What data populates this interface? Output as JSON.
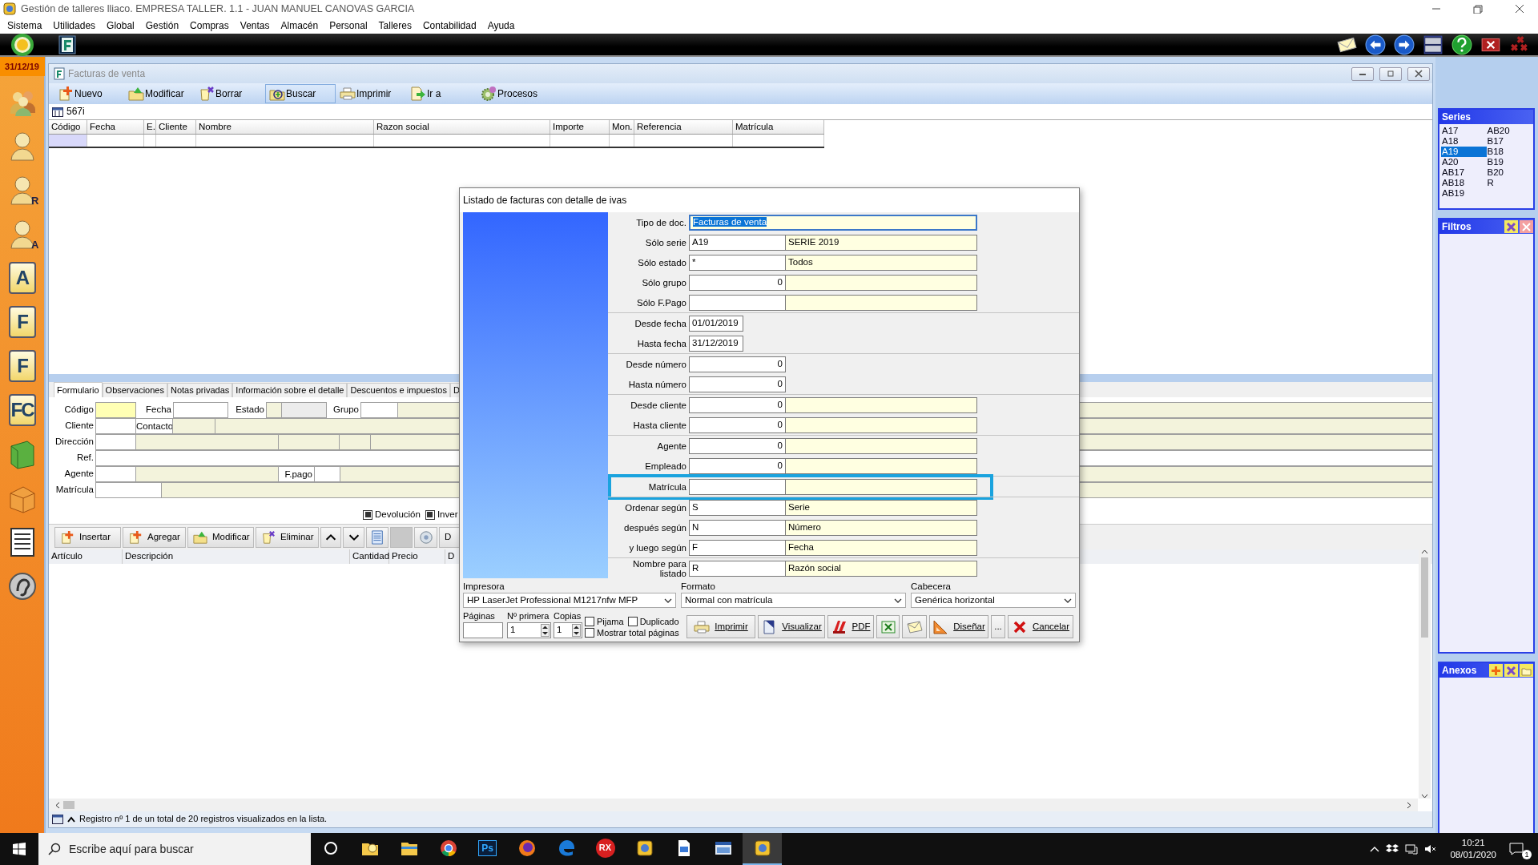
{
  "window": {
    "title": "Gestión de talleres lliaco. EMPRESA TALLER. 1.1 - JUAN MANUEL CANOVAS GARCIA"
  },
  "menu": [
    "Sistema",
    "Utilidades",
    "Global",
    "Gestión",
    "Compras",
    "Ventas",
    "Almacén",
    "Personal",
    "Talleres",
    "Contabilidad",
    "Ayuda"
  ],
  "date_badge": "31/12/19",
  "launcher": [
    {
      "kind": "people"
    },
    {
      "kind": "person"
    },
    {
      "kind": "person",
      "letter": "R"
    },
    {
      "kind": "person",
      "letter": "A"
    },
    {
      "kind": "tile",
      "letter": "A"
    },
    {
      "kind": "tile",
      "letter": "F"
    },
    {
      "kind": "tile",
      "letter": "F"
    },
    {
      "kind": "tile",
      "letter": "FC"
    },
    {
      "kind": "book"
    },
    {
      "kind": "box"
    },
    {
      "kind": "list"
    },
    {
      "kind": "disc"
    }
  ],
  "child_window": {
    "title": "Facturas de venta"
  },
  "toolbar": [
    {
      "label": "Nuevo",
      "kind": "add",
      "selected": false
    },
    {
      "label": "Modificar",
      "kind": "edit",
      "selected": false
    },
    {
      "label": "Borrar",
      "kind": "delete",
      "selected": false
    },
    {
      "label": "Buscar",
      "kind": "search",
      "selected": true
    },
    {
      "label": "Imprimir",
      "kind": "print",
      "selected": false
    },
    {
      "label": "Ir a",
      "kind": "goto",
      "selected": false
    },
    {
      "label": "Procesos",
      "kind": "gear",
      "selected": false
    }
  ],
  "record_search": "567i",
  "grid": {
    "columns": [
      "Código",
      "Fecha",
      "E.",
      "Cliente",
      "Nombre",
      "Razon social",
      "Importe",
      "Mon.",
      "Referencia",
      "Matrícula"
    ]
  },
  "detail_tabs": [
    {
      "label": "Formulario",
      "selected": true
    },
    {
      "label": "Observaciones",
      "selected": false
    },
    {
      "label": "Notas privadas",
      "selected": false
    },
    {
      "label": "Información sobre el detalle",
      "selected": false
    },
    {
      "label": "Descuentos e impuestos",
      "selected": false
    },
    {
      "label": "D",
      "selected": false
    }
  ],
  "form": {
    "labels": [
      "Código",
      "Fecha",
      "Estado",
      "Grupo",
      "Cliente",
      "Contacto",
      "Dirección",
      "Ref.",
      "Agente",
      "F.pago",
      "Matrícula"
    ]
  },
  "flags": [
    {
      "label": "Devolución",
      "checked": true
    },
    {
      "label": "Inver",
      "checked": true
    }
  ],
  "line_buttons": [
    {
      "kind": "add",
      "label": "Insertar"
    },
    {
      "kind": "add",
      "label": "Agregar"
    },
    {
      "kind": "edit",
      "label": "Modificar"
    },
    {
      "kind": "delete",
      "label": "Eliminar"
    },
    {
      "kind": "up"
    },
    {
      "kind": "down"
    },
    {
      "kind": "doc"
    },
    {
      "kind": "blank"
    },
    {
      "kind": "disc"
    },
    {
      "kind": "text",
      "label": "D"
    }
  ],
  "lines": {
    "columns": [
      "Artículo",
      "Descripción",
      "Cantidad",
      "Precio",
      "D"
    ]
  },
  "status_bar": "Registro nº 1 de un total de 20 registros visualizados en la lista.",
  "series": {
    "title": "Series",
    "items": [
      {
        "label": "A17",
        "selected": false
      },
      {
        "label": "A18",
        "selected": false
      },
      {
        "label": "A19",
        "selected": true
      },
      {
        "label": "A20",
        "selected": false
      },
      {
        "label": "AB17",
        "selected": false
      },
      {
        "label": "AB18",
        "selected": false
      },
      {
        "label": "AB19",
        "selected": false
      },
      {
        "label": "AB20",
        "selected": false
      },
      {
        "label": "B17",
        "selected": false
      },
      {
        "label": "B18",
        "selected": false
      },
      {
        "label": "B19",
        "selected": false
      },
      {
        "label": "B20",
        "selected": false
      },
      {
        "label": "R",
        "selected": false
      }
    ]
  },
  "filters": {
    "title": "Filtros"
  },
  "attachments": {
    "title": "Anexos"
  },
  "dialog": {
    "title": "Listado de facturas con detalle de ivas",
    "groups": [
      {
        "rows": [
          {
            "label": "Tipo de doc.",
            "kind": "doc",
            "code": "Facturas de venta",
            "selected_text": true
          },
          {
            "label": "Sólo serie",
            "kind": "pair",
            "code": "A19",
            "description": "SERIE 2019",
            "selected_text": false
          },
          {
            "label": "Sólo estado",
            "kind": "pair",
            "code": "*",
            "description": "Todos",
            "selected_text": false
          },
          {
            "label": "Sólo grupo",
            "kind": "numpair",
            "code": "0",
            "selected_text": false
          },
          {
            "label": "Sólo F.Pago",
            "kind": "pair"
          }
        ]
      },
      {
        "rows": [
          {
            "label": "Desde fecha",
            "kind": "date",
            "code": "01/01/2019",
            "selected_text": false
          },
          {
            "label": "Hasta fecha",
            "kind": "date",
            "code": "31/12/2019",
            "selected_text": false
          }
        ]
      },
      {
        "rows": [
          {
            "label": "Desde número",
            "kind": "num",
            "code": "0",
            "selected_text": false
          },
          {
            "label": "Hasta número",
            "kind": "num",
            "code": "0",
            "selected_text": false
          }
        ]
      },
      {
        "rows": [
          {
            "label": "Desde cliente",
            "kind": "numpair",
            "code": "0",
            "selected_text": false
          },
          {
            "label": "Hasta cliente",
            "kind": "numpair",
            "code": "0",
            "selected_text": false
          }
        ]
      },
      {
        "rows": [
          {
            "label": "Agente",
            "kind": "numpair",
            "code": "0",
            "selected_text": false
          },
          {
            "label": "Empleado",
            "kind": "numpair",
            "code": "0",
            "selected_text": false
          }
        ]
      },
      {
        "rows": [
          {
            "label": "Matrícula",
            "kind": "pair",
            "highlighted": true
          }
        ]
      },
      {
        "rows": [
          {
            "label": "Ordenar según",
            "kind": "pair",
            "code": "S",
            "description": "Serie",
            "selected_text": false
          },
          {
            "label": "después según",
            "kind": "pair",
            "code": "N",
            "description": "Número",
            "selected_text": false
          },
          {
            "label": "y luego según",
            "kind": "pair",
            "code": "F",
            "description": "Fecha",
            "selected_text": false
          }
        ]
      },
      {
        "rows": [
          {
            "label": "Nombre para listado",
            "kind": "pair",
            "code": "R",
            "description": "Razón social",
            "selected_text": false
          }
        ]
      }
    ],
    "selects": [
      {
        "label": "Impresora",
        "value": "HP LaserJet Professional M1217nfw MFP"
      },
      {
        "label": "Formato",
        "value": "Normal con matrícula"
      },
      {
        "label": "Cabecera",
        "value": "Genérica horizontal"
      }
    ],
    "pages": {
      "label": "Páginas"
    },
    "first_page": {
      "label": "Nº primera",
      "value": "1"
    },
    "copies": {
      "label": "Copias",
      "value": "1"
    },
    "options": [
      {
        "label": "Pijama",
        "checked": false
      },
      {
        "label": "Duplicado",
        "checked": false
      },
      {
        "label": "Mostrar total páginas",
        "checked": false
      }
    ],
    "buttons": [
      {
        "kind": "print",
        "label": "Imprimir"
      },
      {
        "kind": "view",
        "label": "Visualizar"
      },
      {
        "kind": "pdf",
        "label": "PDF"
      },
      {
        "kind": "excel"
      },
      {
        "kind": "mail"
      },
      {
        "kind": "design",
        "label": "Diseñar"
      },
      {
        "kind": "text",
        "label": "..."
      },
      {
        "kind": "cancel",
        "label": "Cancelar"
      }
    ]
  },
  "taskbar": {
    "search_placeholder": "Escribe aquí para buscar",
    "apps": [
      {
        "kind": "circle",
        "selected": false
      },
      {
        "kind": "notes",
        "selected": false
      },
      {
        "kind": "folder",
        "selected": false
      },
      {
        "kind": "chrome",
        "selected": false
      },
      {
        "kind": "badge",
        "label": "Ps",
        "selected": false
      },
      {
        "kind": "firefox",
        "selected": false
      },
      {
        "kind": "edge",
        "selected": false
      },
      {
        "kind": "rx",
        "label": "RX",
        "selected": false
      },
      {
        "kind": "app",
        "selected": false
      },
      {
        "kind": "doc",
        "selected": false
      },
      {
        "kind": "window",
        "selected": false
      },
      {
        "kind": "app",
        "selected": true
      }
    ],
    "time": "10:21",
    "date": "08/01/2020",
    "notifications": "1"
  }
}
